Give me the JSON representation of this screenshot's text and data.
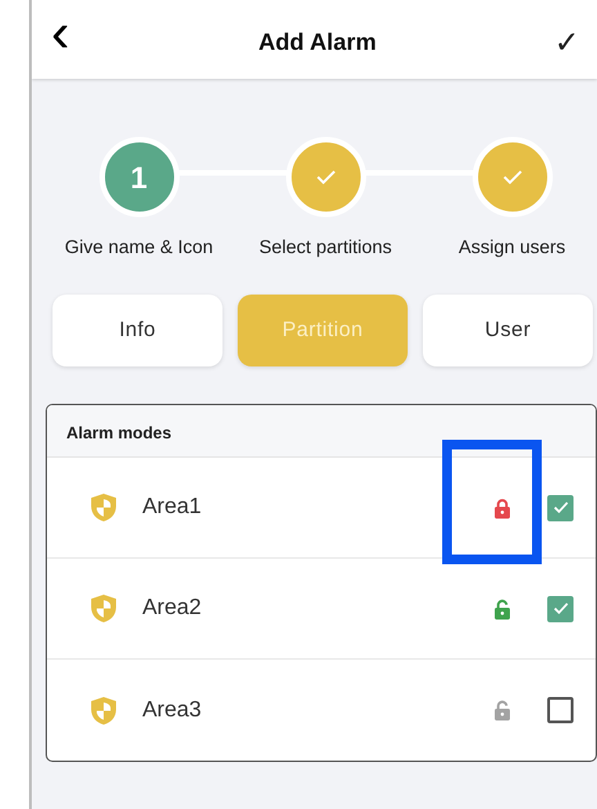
{
  "header": {
    "title": "Add Alarm",
    "back": "‹",
    "confirm": "✓"
  },
  "steps": [
    {
      "label": "Give name & Icon",
      "done": false,
      "number": "1"
    },
    {
      "label": "Select partitions",
      "done": true
    },
    {
      "label": "Assign users",
      "done": true
    }
  ],
  "tabs": [
    {
      "label": "Info",
      "selected": false
    },
    {
      "label": "Partition",
      "selected": true
    },
    {
      "label": "User",
      "selected": false
    }
  ],
  "section": {
    "title": "Alarm modes"
  },
  "areas": [
    {
      "name": "Area1",
      "locked": true,
      "color": "#e5484d",
      "checked": true,
      "highlighted": true
    },
    {
      "name": "Area2",
      "locked": false,
      "color": "#3fa34d",
      "checked": true,
      "highlighted": false
    },
    {
      "name": "Area3",
      "locked": false,
      "color": "#a3a3a3",
      "checked": false,
      "highlighted": false
    }
  ]
}
